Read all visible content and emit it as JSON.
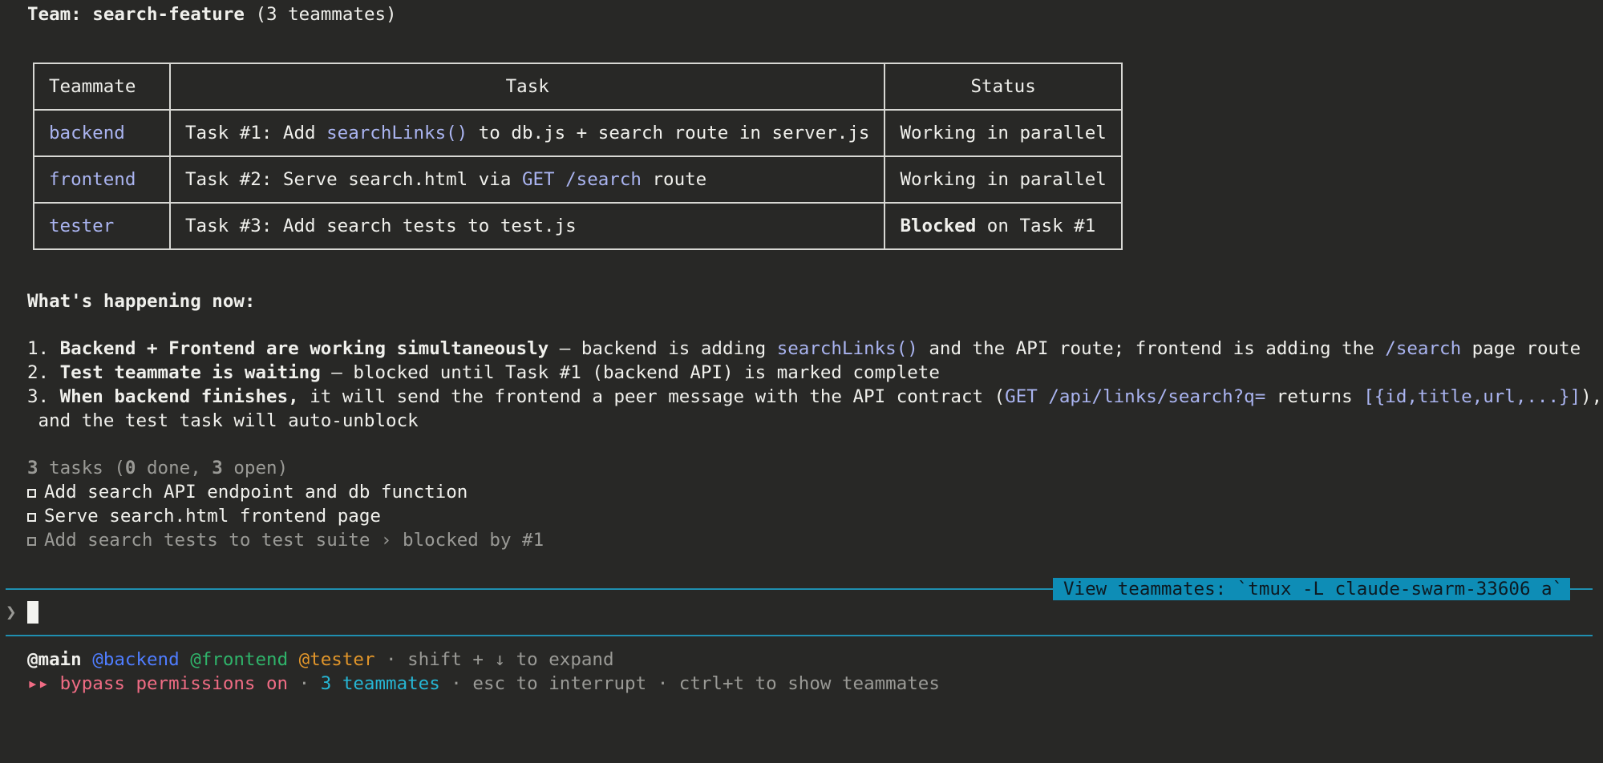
{
  "header": {
    "team_label": "Team: ",
    "team_name": "search-feature",
    "team_count": " (3 teammates)"
  },
  "table": {
    "columns": [
      "Teammate",
      "Task",
      "Status"
    ],
    "rows": [
      {
        "name": "backend",
        "task_prefix": "Task #1: Add ",
        "task_code": "searchLinks()",
        "task_suffix": " to db.js + search route in server.js",
        "status_bold": "",
        "status_text": "Working in parallel"
      },
      {
        "name": "frontend",
        "task_prefix": "Task #2: Serve search.html via ",
        "task_code": "GET /search",
        "task_suffix": " route",
        "status_bold": "",
        "status_text": "Working in parallel"
      },
      {
        "name": "tester",
        "task_prefix": "Task #3: Add search tests to test.js",
        "task_code": "",
        "task_suffix": "",
        "status_bold": "Blocked",
        "status_text": " on Task #1"
      }
    ]
  },
  "happening": {
    "heading": "What's happening now:",
    "items": [
      {
        "num": "1. ",
        "bold": "Backend + Frontend are working simultaneously",
        "t1": " — backend is adding ",
        "c1": "searchLinks()",
        "t2": " and the API route; frontend is adding the ",
        "c2": "/search",
        "t3": " page route"
      },
      {
        "num": "2. ",
        "bold": "Test teammate is waiting",
        "t1": " — blocked until Task #1 (backend API) is marked complete"
      },
      {
        "num": "3. ",
        "bold": "When backend finishes,",
        "t1": " it will send the frontend a peer message with the API contract (",
        "c1": "GET /api/links/search?q=",
        "t2": " returns ",
        "c2": "[{id,title,url,...}]",
        "t3": "),",
        "cont": " and the test task will auto-unblock"
      }
    ]
  },
  "tasks": {
    "count": "3",
    "label_a": " tasks (",
    "done": "0",
    "label_b": " done, ",
    "open": "3",
    "label_c": " open)",
    "list": [
      "Add search API endpoint and db function",
      "Serve search.html frontend page",
      "Add search tests to test suite › blocked by #1"
    ]
  },
  "banner": "View teammates: `tmux -L claude-swarm-33606 a`",
  "prompt": {
    "symbol": "❯"
  },
  "footer": {
    "main": "@main",
    "backend": "@backend",
    "frontend": "@frontend",
    "tester": "@tester",
    "expand_hint": " · shift + ↓ to expand",
    "bypass": "▸▸ bypass permissions on",
    "sep1": " · ",
    "teammates": "3 teammates",
    "interrupt": " · esc to interrupt · ctrl+t to show teammates"
  },
  "colors": {
    "background": "#282826",
    "link": "#aab4f0",
    "accent_line": "#1f8fb0",
    "banner_bg": "#0e8db6",
    "bypass": "#f06c84",
    "backend": "#4f7dff",
    "frontend": "#2fb36a",
    "tester": "#e0952a",
    "teammates": "#26b6d4"
  }
}
